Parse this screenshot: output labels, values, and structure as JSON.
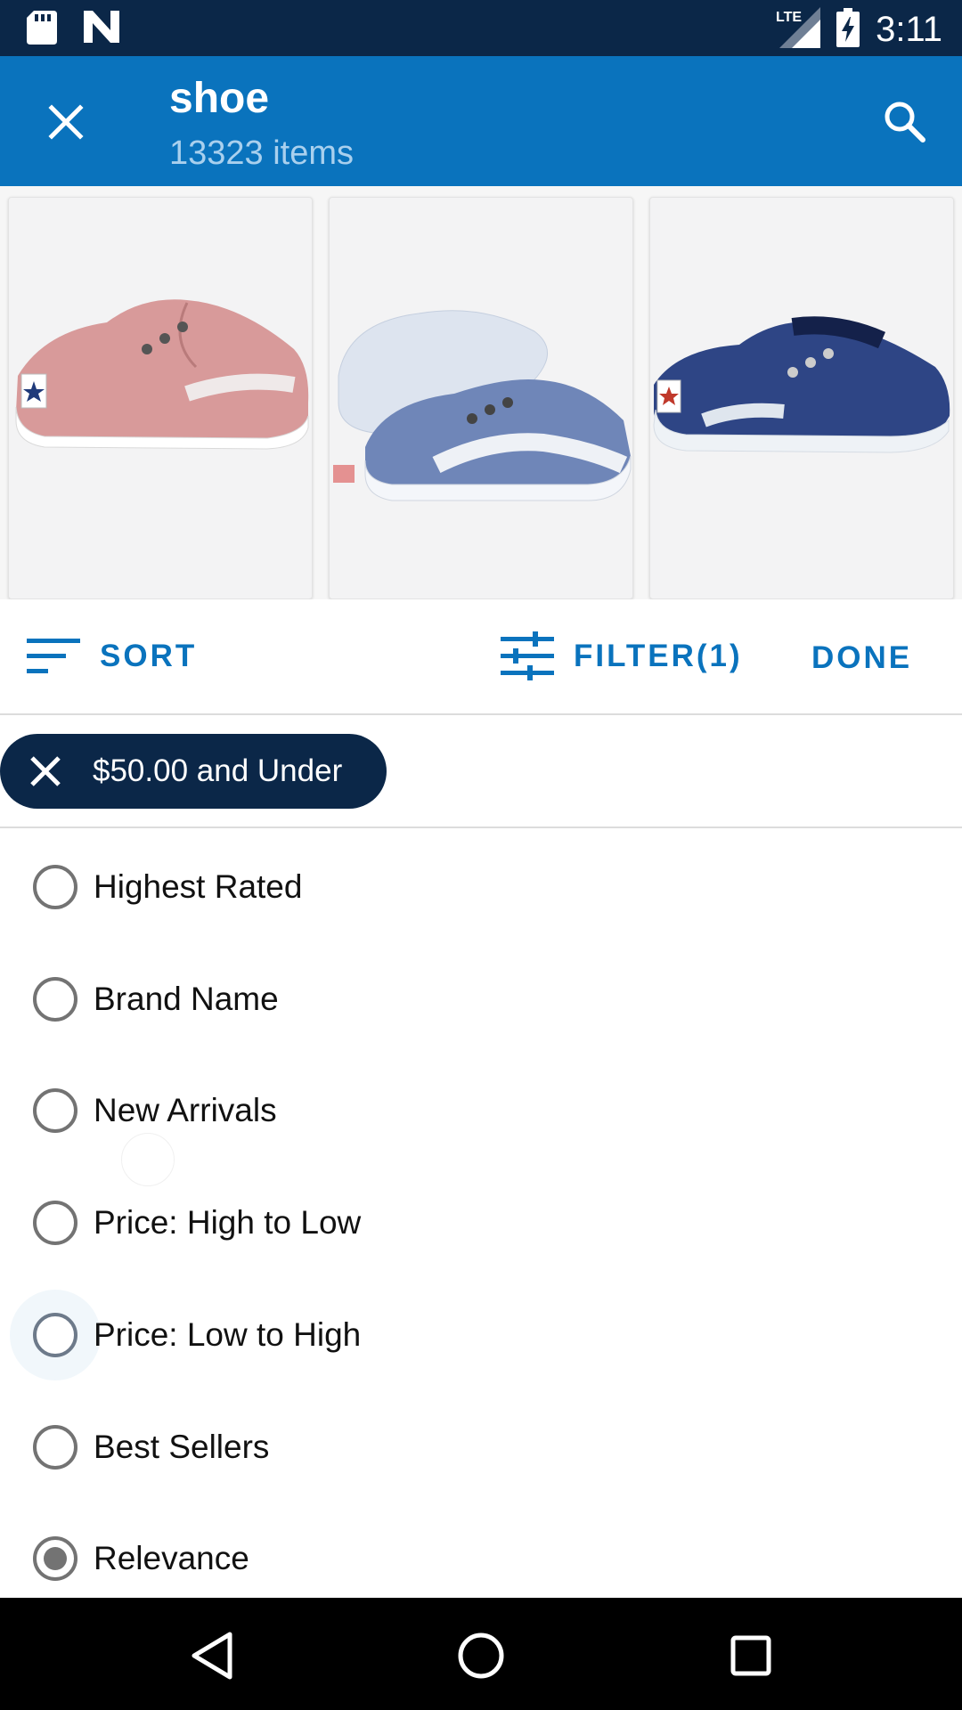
{
  "status_bar": {
    "time": "3:11",
    "icons": [
      "sd-card-icon",
      "n-notification-icon",
      "lte-signal-icon",
      "battery-charging-icon"
    ],
    "network_label": "LTE"
  },
  "app_bar": {
    "title": "shoe",
    "subtitle": "13323 items",
    "close_icon": "close-icon",
    "search_icon": "search-icon",
    "color": "#0a73bd"
  },
  "products": [
    {
      "icon": "pink-canvas-shoe",
      "color": "#d89a9a"
    },
    {
      "icon": "light-blue-canvas-shoes",
      "color": "#6f86b8"
    },
    {
      "icon": "navy-canvas-shoe",
      "color": "#2e4585"
    }
  ],
  "toolbar": {
    "sort_label": "SORT",
    "filter_label": "FILTER(1)",
    "done_label": "DONE",
    "accent": "#0a73bd"
  },
  "active_filter": {
    "label": "$50.00 and Under",
    "chip_color": "#0b2748"
  },
  "sort_options": [
    {
      "label": "Highest Rated",
      "selected": false
    },
    {
      "label": "Brand Name",
      "selected": false
    },
    {
      "label": "New Arrivals",
      "selected": false
    },
    {
      "label": "Price: High to Low",
      "selected": false
    },
    {
      "label": "Price: Low to High",
      "selected": false
    },
    {
      "label": "Best Sellers",
      "selected": false
    },
    {
      "label": "Relevance",
      "selected": true
    }
  ],
  "nav_bar": {
    "icons": [
      "back-icon",
      "home-icon",
      "recents-icon"
    ]
  }
}
